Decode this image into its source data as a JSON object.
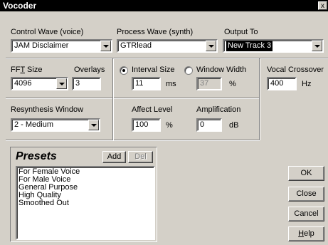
{
  "window": {
    "title": "Vocoder",
    "close_glyph": "x"
  },
  "control_wave": {
    "label": "Control Wave (voice)",
    "value": "JAM Disclaimer"
  },
  "process_wave": {
    "label": "Process Wave (synth)",
    "value": "GTRlead"
  },
  "output_to": {
    "label": "Output To",
    "value": "New Track 3"
  },
  "fft": {
    "label_pre": "FF",
    "label_ul": "T",
    "label_post": " Size",
    "value": "4096"
  },
  "overlays": {
    "label": "Overlays",
    "value": "3"
  },
  "interval": {
    "label": "Interval Size",
    "value": "11",
    "unit": "ms"
  },
  "window_width": {
    "label": "Window Width",
    "value": "37",
    "unit": "%"
  },
  "vocal_crossover": {
    "label": "Vocal Crossover",
    "value": "400",
    "unit": "Hz"
  },
  "resynthesis": {
    "label": "Resynthesis Window",
    "value": "2 - Medium"
  },
  "affect_level": {
    "label": "Affect Level",
    "value": "100",
    "unit": "%"
  },
  "amplification": {
    "label": "Amplification",
    "value": "0",
    "unit": "dB"
  },
  "presets": {
    "title": "Presets",
    "add_label": "Add",
    "del_label": "Del",
    "items": [
      "For Female Voice",
      "For Male Voice",
      "General Purpose",
      "High Quality",
      "Smoothed Out"
    ]
  },
  "buttons": {
    "ok": "OK",
    "close": "Close",
    "cancel": "Cancel",
    "help_ul": "H",
    "help_rest": "elp"
  }
}
